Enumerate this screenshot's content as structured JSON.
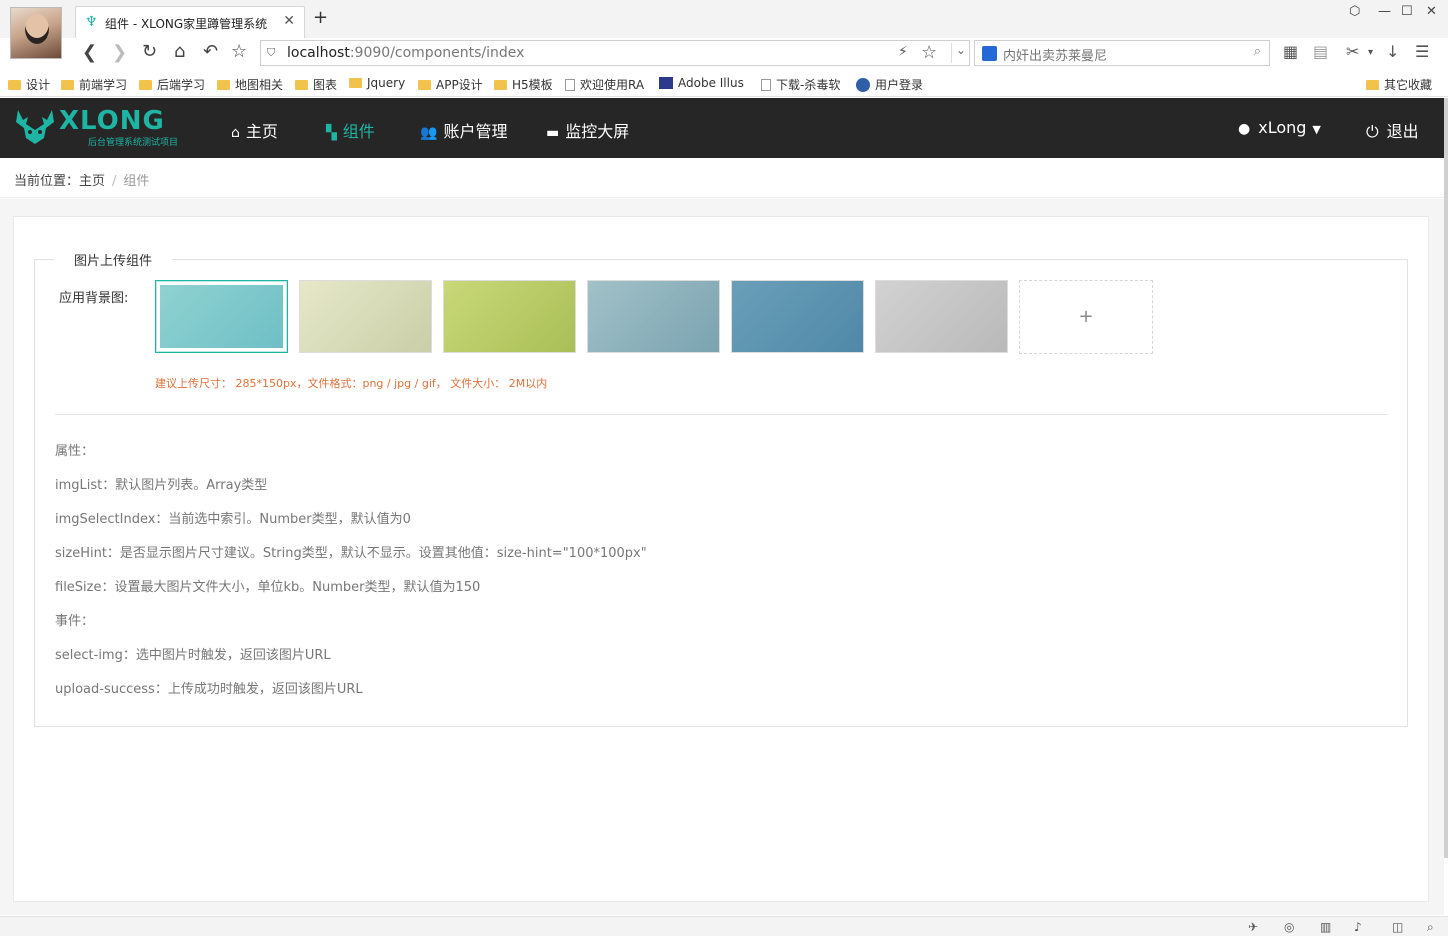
{
  "browser": {
    "tab_title": "组件 - XLONG家里蹲管理系统",
    "new_tab": "+",
    "tab_close": "✕",
    "url_host": "localhost",
    "url_path": ":9090/components/index",
    "search_placeholder": "内奸出卖苏莱曼尼",
    "bookmarks": [
      {
        "label": "设计",
        "icon": "folder-icon"
      },
      {
        "label": "前端学习",
        "icon": "folder-icon"
      },
      {
        "label": "后端学习",
        "icon": "folder-icon"
      },
      {
        "label": "地图相关",
        "icon": "folder-icon"
      },
      {
        "label": "图表",
        "icon": "folder-icon"
      },
      {
        "label": "Jquery",
        "icon": "folder-icon"
      },
      {
        "label": "APP设计",
        "icon": "folder-icon"
      },
      {
        "label": "H5模板",
        "icon": "folder-icon"
      },
      {
        "label": "欢迎使用RA",
        "icon": "page-icon"
      },
      {
        "label": "Adobe Illus",
        "icon": "adobe-icon"
      },
      {
        "label": "下载-杀毒软",
        "icon": "page-icon"
      },
      {
        "label": "用户登录",
        "icon": "globe-icon"
      }
    ],
    "other_bookmarks": "其它收藏"
  },
  "app": {
    "logo_text": "XLONG",
    "logo_sub": "后台管理系统测试项目",
    "menu": [
      {
        "label": "主页",
        "icon": "home-icon",
        "active": false
      },
      {
        "label": "组件",
        "icon": "grid-icon",
        "active": true
      },
      {
        "label": "账户管理",
        "icon": "users-icon",
        "active": false
      },
      {
        "label": "监控大屏",
        "icon": "monitor-icon",
        "active": false
      }
    ],
    "user_name": "xLong",
    "logout_label": "退出",
    "accent_color": "#1fb5a5"
  },
  "breadcrumb": {
    "prefix": "当前位置：",
    "home": "主页",
    "separator": "/",
    "current": "组件"
  },
  "upload": {
    "legend": "图片上传组件",
    "field_label": "应用背景图:",
    "add_symbol": "+",
    "selected_index": 0,
    "thumbnails": [
      {
        "name": "thumb-1",
        "colors": [
          "#8fd2d0",
          "#6fbfc6"
        ]
      },
      {
        "name": "thumb-2",
        "colors": [
          "#e6e8c8",
          "#c9cfa8"
        ]
      },
      {
        "name": "thumb-3",
        "colors": [
          "#c9d879",
          "#a9bf56"
        ]
      },
      {
        "name": "thumb-4",
        "colors": [
          "#a2c1c8",
          "#7aa3b0"
        ]
      },
      {
        "name": "thumb-5",
        "colors": [
          "#6a9fb8",
          "#4f88a8"
        ]
      },
      {
        "name": "thumb-6",
        "colors": [
          "#d2d2d2",
          "#b9b9b9"
        ]
      }
    ],
    "hint": "建议上传尺寸：  285*150px，文件格式：png / jpg / gif，  文件大小：  2M以内"
  },
  "docs": {
    "lines": [
      "属性：",
      "imgList：默认图片列表。Array类型",
      "imgSelectIndex：当前选中索引。Number类型，默认值为0",
      "sizeHint：是否显示图片尺寸建议。String类型，默认不显示。设置其他值：size-hint=\"100*100px\"",
      "fileSize：设置最大图片文件大小，单位kb。Number类型，默认值为150",
      "事件：",
      "select-img：选中图片时触发，返回该图片URL",
      "upload-success：上传成功时触发，返回该图片URL"
    ]
  }
}
